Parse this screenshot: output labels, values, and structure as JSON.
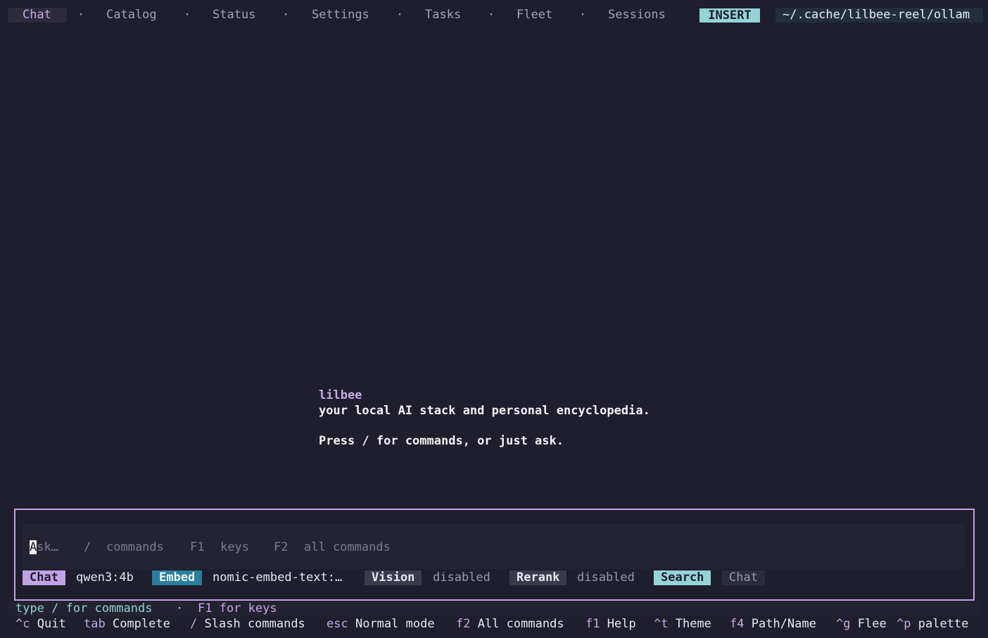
{
  "tabs": [
    {
      "label": "Chat",
      "active": true
    },
    {
      "label": "Catalog"
    },
    {
      "label": "Status"
    },
    {
      "label": "Settings"
    },
    {
      "label": "Tasks"
    },
    {
      "label": "Fleet"
    },
    {
      "label": "Sessions"
    }
  ],
  "tab_separator": "·",
  "mode": "INSERT",
  "path": "~/.cache/lilbee-reel/ollam",
  "welcome": {
    "name": "lilbee",
    "tagline": "your local AI stack and personal encyclopedia.",
    "prompt": "Press / for commands, or just ask."
  },
  "input": {
    "cursor_char": "A",
    "placeholder_rest": "sk…",
    "hints": [
      "/",
      "commands",
      "F1",
      "keys",
      "F2",
      "all commands"
    ]
  },
  "status": {
    "chat_label": "Chat",
    "chat_value": "qwen3:4b",
    "embed_label": "Embed",
    "embed_value": "nomic-embed-text:…",
    "vision_label": "Vision",
    "vision_value": "disabled",
    "rerank_label": "Rerank",
    "rerank_value": "disabled",
    "search_label": "Search",
    "search_value": "Chat"
  },
  "footer_hint": {
    "part1": "type / for commands",
    "dot": "·",
    "part2": "F1 for keys"
  },
  "shortcuts": [
    {
      "key": "^c",
      "label": "Quit"
    },
    {
      "key": "tab",
      "label": "Complete"
    },
    {
      "key": "/",
      "label": "Slash commands"
    },
    {
      "key": "esc",
      "label": "Normal mode"
    },
    {
      "key": "f2",
      "label": "All commands"
    },
    {
      "key": "f1",
      "label": "Help"
    },
    {
      "key": "^t",
      "label": "Theme"
    },
    {
      "key": "f4",
      "label": "Path/Name"
    },
    {
      "key": "^g",
      "label": "Flee"
    },
    {
      "key": "^p",
      "label": "palette"
    }
  ],
  "colors": {
    "background": "#1e1e2c",
    "accent_purple": "#c9a6ea",
    "accent_teal": "#94d4d8",
    "embed_blue": "#2a7f9c"
  }
}
